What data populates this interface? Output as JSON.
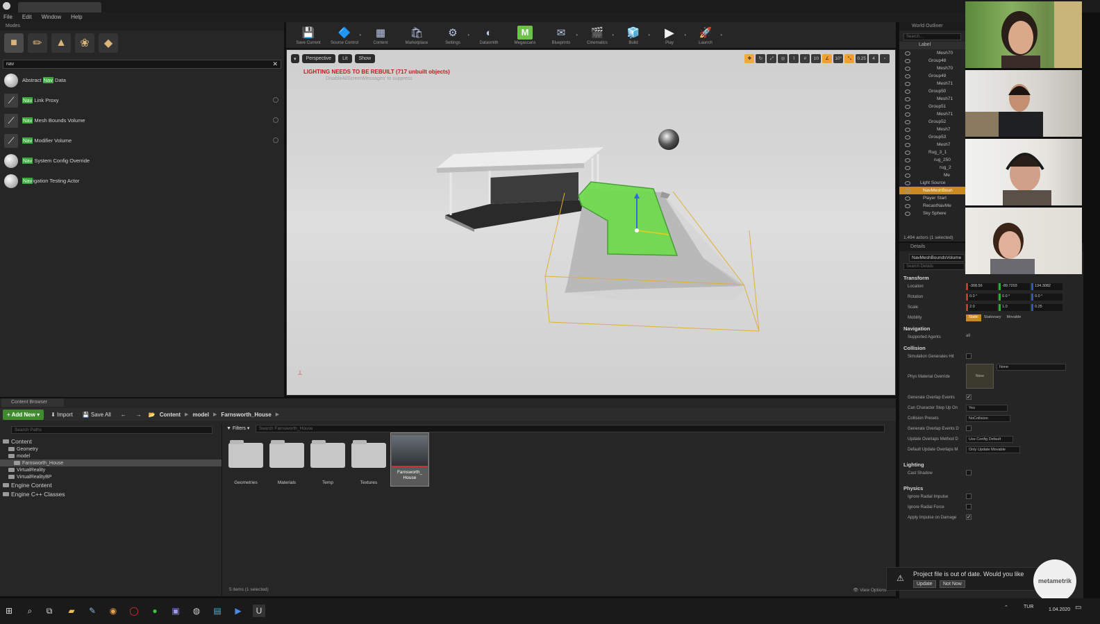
{
  "window": {
    "project_tab": "",
    "menu": [
      "File",
      "Edit",
      "Window",
      "Help"
    ]
  },
  "modes": {
    "title": "Modes",
    "search_value": "nav",
    "items": [
      {
        "pre": "Abstract ",
        "hl": "Nav",
        "post": " Data",
        "icon": "sphere"
      },
      {
        "pre": "",
        "hl": "Nav",
        "post": " Link Proxy",
        "icon": "volume"
      },
      {
        "pre": "",
        "hl": "Nav",
        "post": " Mesh Bounds Volume",
        "icon": "volume"
      },
      {
        "pre": "",
        "hl": "Nav",
        "post": " Modifier Volume",
        "icon": "volume"
      },
      {
        "pre": "",
        "hl": "Nav",
        "post": " System Config Override",
        "icon": "sphere"
      },
      {
        "pre": "",
        "hl": "Nav",
        "post": "igation Testing Actor",
        "icon": "sphere"
      }
    ]
  },
  "toolbar": {
    "items": [
      "Save Current",
      "Source Control",
      "Content",
      "Marketplace",
      "Settings",
      "Datasmith",
      "Megascans",
      "Blueprints",
      "Cinematics",
      "Build",
      "Play",
      "Launch"
    ]
  },
  "viewport": {
    "perspective": "Perspective",
    "lit": "Lit",
    "show": "Show",
    "warning": "LIGHTING NEEDS TO BE REBUILT (717 unbuilt objects)",
    "warning_sub": "DisableAllScreenMessages' to suppress",
    "snap_values": [
      "10",
      "10°",
      "0.25",
      "4"
    ]
  },
  "outliner": {
    "title": "World Outliner",
    "search_placeholder": "Search...",
    "col": "Label",
    "rows": [
      "Mesh70",
      "Group48",
      "Mesh70",
      "Group49",
      "Mesh71",
      "Group50",
      "Mesh71",
      "Group51",
      "Mesh71",
      "Group52",
      "Mesh7",
      "Group53",
      "Mesh7",
      "Rug_3_1",
      "rug_250",
      "rug_2",
      "Me",
      "Light Source",
      "NavMeshBoun",
      "Player Start",
      "RecastNavMe",
      "Sky Sphere"
    ],
    "selected_index": 18,
    "footer": "1,494 actors (1 selected)"
  },
  "details": {
    "title": "Details",
    "object_name": "NavMeshBoundsVolume",
    "search_placeholder": "Search Details",
    "transform": {
      "header": "Transform",
      "location_label": "Location",
      "rotation_label": "Rotation",
      "scale_label": "Scale",
      "mobility_label": "Mobility",
      "location": [
        "-308.56",
        "-89.7203",
        "134.3082"
      ],
      "rotation": [
        "0.0 °",
        "0.0 °",
        "0.0 °"
      ],
      "scale": [
        "2.0",
        "1.0",
        "0.25"
      ],
      "mobility": [
        "Static",
        "Stationary",
        "Movable"
      ]
    },
    "navigation": {
      "header": "Navigation",
      "label": "Supported Agents",
      "value": "all"
    },
    "collision": {
      "header": "Collision",
      "sim_hit": "Simulation Generates Hit",
      "phys_mat": "Phys Material Override",
      "phys_value": "None",
      "gen_overlap": "Generate Overlap Events",
      "step_up": "Can Character Step Up On",
      "step_up_value": "Yes",
      "presets": "Collision Presets",
      "presets_value": "NoCollision",
      "gen_overlap2": "Generate Overlap Events D",
      "update_method": "Update Overlaps Method D",
      "update_method_value": "Use Config Default",
      "default_update": "Default Update Overlaps M",
      "default_update_value": "Only Update Movable"
    },
    "lighting": {
      "header": "Lighting",
      "cast_shadow": "Cast Shadow"
    },
    "physics": {
      "header": "Physics",
      "radial_impulse": "Ignore Radial Impulse",
      "radial_force": "Ignore Radial Force",
      "impulse_damage": "Apply Impulse on Damage"
    }
  },
  "content_browser": {
    "tab": "Content Browser",
    "add_new": "Add New",
    "import": "Import",
    "save_all": "Save All",
    "breadcrumb": [
      "Content",
      "model",
      "Farnsworth_House"
    ],
    "path_search": "Search Paths",
    "tree": [
      {
        "label": "Content",
        "level": 0,
        "big": true
      },
      {
        "label": "Geometry",
        "level": 1
      },
      {
        "label": "model",
        "level": 1
      },
      {
        "label": "Farnsworth_House",
        "level": 2,
        "sel": true
      },
      {
        "label": "VirtualReality",
        "level": 1
      },
      {
        "label": "VirtualRealityBP",
        "level": 1
      },
      {
        "label": "Engine Content",
        "level": 0,
        "big": true
      },
      {
        "label": "Engine C++ Classes",
        "level": 0,
        "big": true
      }
    ],
    "filters": "Filters",
    "asset_search": "Search Farnsworth_House",
    "assets": [
      "Geometries",
      "Materials",
      "Temp",
      "Textures"
    ],
    "selected_asset": "Farnsworth_ House",
    "footer": "5 items (1 selected)",
    "view_options": "View Options"
  },
  "notification": {
    "text": "Project file is out of date. Would you like",
    "update": "Update",
    "not_now": "Not Now"
  },
  "logo": "metametrik",
  "taskbar": {
    "lang": "TUR",
    "date": "1.04.2020"
  }
}
